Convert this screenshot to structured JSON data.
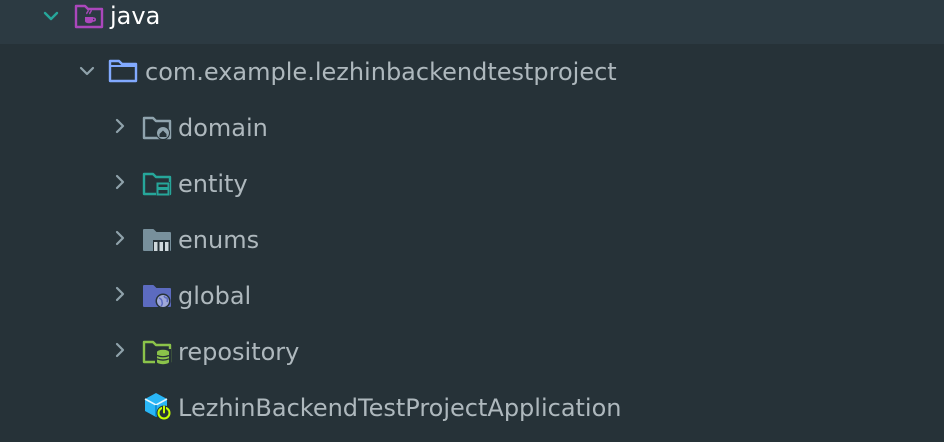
{
  "tree": {
    "java": {
      "label": "java",
      "icon": "java-source-folder-icon",
      "expanded": true
    },
    "package": {
      "label": "com.example.lezhinbackendtestproject",
      "icon": "folder-icon",
      "expanded": true
    },
    "items": [
      {
        "label": "domain",
        "icon": "domain-folder-icon",
        "expanded": false
      },
      {
        "label": "entity",
        "icon": "entity-folder-icon",
        "expanded": false
      },
      {
        "label": "enums",
        "icon": "enums-folder-icon",
        "expanded": false
      },
      {
        "label": "global",
        "icon": "global-folder-icon",
        "expanded": false
      },
      {
        "label": "repository",
        "icon": "repository-folder-icon",
        "expanded": false
      }
    ],
    "app": {
      "label": "LezhinBackendTestProjectApplication",
      "icon": "spring-boot-application-icon"
    }
  },
  "colors": {
    "background": "#263238",
    "selected_row": "#2c3a42",
    "chevron_expanded_java": "#26a69a",
    "chevron": "#8fa2ab",
    "text": "#aeb8bd",
    "text_selected": "#ffffff",
    "java_folder": "#ab47bc",
    "package_folder": "#82aaff",
    "domain_folder": "#90a4ae",
    "entity_folder": "#26a69a",
    "enums_folder": "#78909c",
    "global_folder": "#5c6bc0",
    "repository_folder": "#8bc34a",
    "app_icon": "#29b6f6"
  }
}
